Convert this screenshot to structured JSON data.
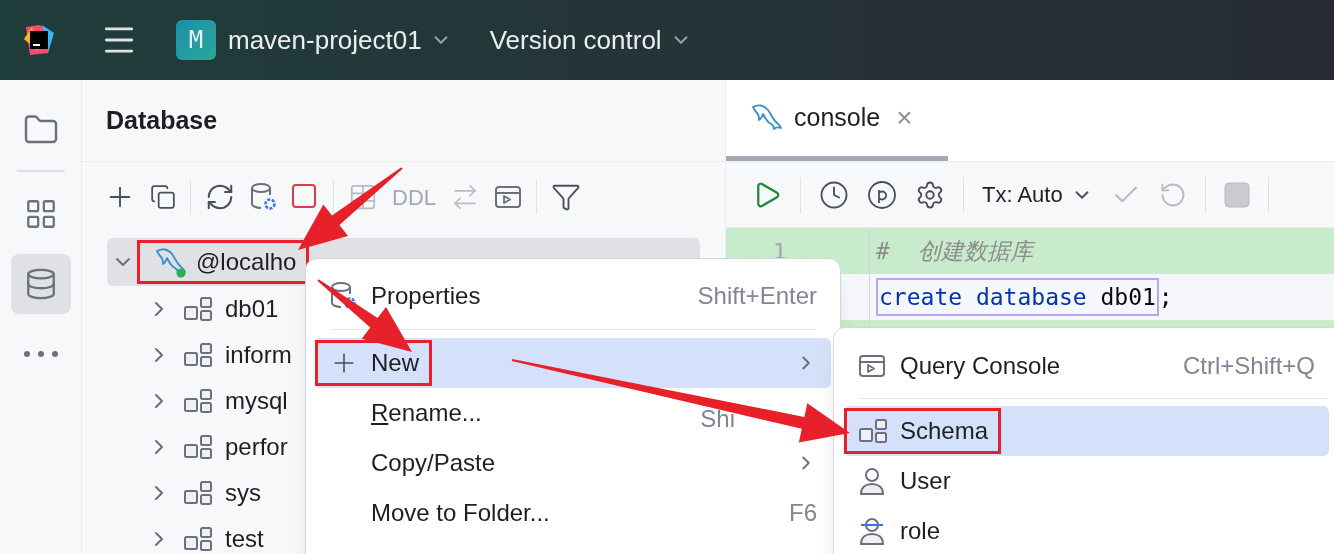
{
  "title_bar": {
    "project_badge": "M",
    "project": "maven-project01",
    "vcs": "Version control"
  },
  "tool_strip": [
    {
      "kind": "folder",
      "selected": false
    },
    {
      "kind": "structure",
      "selected": false
    },
    {
      "kind": "database",
      "selected": true
    },
    {
      "kind": "more",
      "selected": false
    }
  ],
  "database_panel": {
    "title": "Database",
    "ddl_label": "DDL",
    "tree": {
      "label": "@localho",
      "expanded": true,
      "selected": true,
      "highlighted": true,
      "connected": true,
      "children": [
        {
          "label": "db01",
          "expanded": false
        },
        {
          "label": "inform",
          "expanded": false
        },
        {
          "label": "mysql",
          "expanded": false
        },
        {
          "label": "perfor",
          "expanded": false
        },
        {
          "label": "sys",
          "expanded": false
        },
        {
          "label": "test",
          "expanded": false
        }
      ]
    }
  },
  "editor": {
    "tabs": [
      {
        "label": "console",
        "selected": true,
        "close": "×"
      }
    ],
    "tx_mode": "Tx: Auto",
    "lines": [
      {
        "number": "1",
        "kind": "comment",
        "text": "#  创建数据库"
      },
      {
        "kind": "code",
        "highlighted": true,
        "tokens": [
          {
            "text": "create",
            "kind": "keyword"
          },
          {
            "text": "database",
            "kind": "keyword"
          },
          {
            "text": "db01",
            "kind": "ident"
          },
          {
            "text": ";",
            "kind": "punct"
          }
        ]
      },
      {
        "kind": "empty"
      }
    ]
  },
  "context_menu": {
    "items": [
      {
        "kind": "item",
        "label": "Properties",
        "shortcut": "Shift+Enter",
        "selected": false,
        "highlighted": false
      },
      {
        "kind": "separator"
      },
      {
        "kind": "item",
        "label": "New",
        "submenu": true,
        "selected": true,
        "highlighted": true
      },
      {
        "kind": "item",
        "label": "Rename...",
        "shortcut_fragment": "Shi",
        "selected": false,
        "highlighted": false,
        "mnemonic": true
      },
      {
        "kind": "item",
        "label": "Copy/Paste",
        "submenu": true,
        "selected": false,
        "highlighted": false
      },
      {
        "kind": "item",
        "label": "Move to Folder...",
        "shortcut": "F6",
        "selected": false,
        "highlighted": false
      }
    ]
  },
  "submenu": {
    "items": [
      {
        "kind": "item",
        "label": "Query Console",
        "shortcut": "Ctrl+Shift+Q",
        "selected": false,
        "highlighted": false
      },
      {
        "kind": "separator"
      },
      {
        "kind": "item",
        "label": "Schema",
        "selected": true,
        "highlighted": true
      },
      {
        "kind": "item",
        "label": "User",
        "selected": false,
        "highlighted": false
      },
      {
        "kind": "item",
        "label": "role",
        "selected": false,
        "highlighted": false
      }
    ]
  }
}
